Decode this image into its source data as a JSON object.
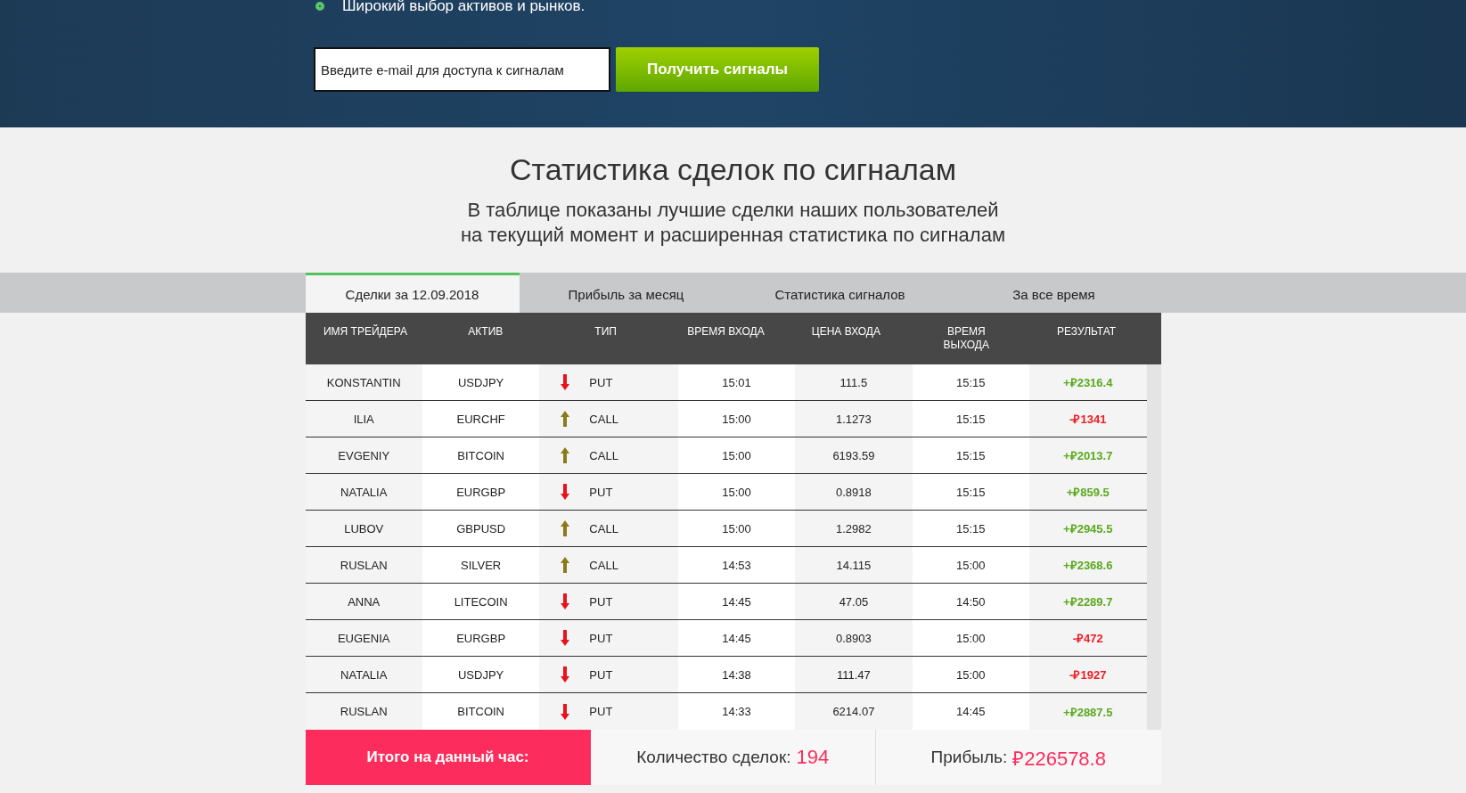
{
  "hero": {
    "feature": "Широкий выбор активов и рынков.",
    "email_field": {
      "placeholder": "Введите e-mail для доступа к сигналам"
    },
    "submit_button": "Получить сигналы"
  },
  "heading": {
    "title": "Статистика сделок по сигналам",
    "subtitle_lines": [
      "В таблице показаны лучшие сделки наших пользователей",
      "на текущий момент и расширенная статистика по сигналам"
    ]
  },
  "tabs": [
    {
      "label": "Сделки за 12.09.2018",
      "selected": true
    },
    {
      "label": "Прибыль за месяц",
      "selected": false
    },
    {
      "label": "Статистика сигналов",
      "selected": false
    },
    {
      "label": "За все время",
      "selected": false
    }
  ],
  "table": {
    "columns": [
      [
        "ИМЯ ТРЕЙДЕРА"
      ],
      [
        "АКТИВ"
      ],
      [
        "ТИП"
      ],
      [
        "ВРЕМЯ ВХОДА"
      ],
      [
        "ЦЕНА ВХОДА"
      ],
      [
        "ВРЕМЯ",
        "ВЫХОДА"
      ],
      [
        "РЕЗУЛЬТАТ"
      ]
    ],
    "rows": [
      {
        "trader": "KONSTANTIN",
        "asset": "USDJPY",
        "rising": false,
        "type": "PUT",
        "entry_time": "15:01",
        "entry_price": "111.5",
        "exit_time": "15:15",
        "result": "+₽2316.4",
        "profit": true
      },
      {
        "trader": "ILIA",
        "asset": "EURCHF",
        "rising": true,
        "type": "CALL",
        "entry_time": "15:00",
        "entry_price": "1.1273",
        "exit_time": "15:15",
        "result": "-₽1341",
        "profit": false
      },
      {
        "trader": "EVGENIY",
        "asset": "BITCOIN",
        "rising": true,
        "type": "CALL",
        "entry_time": "15:00",
        "entry_price": "6193.59",
        "exit_time": "15:15",
        "result": "+₽2013.7",
        "profit": true
      },
      {
        "trader": "NATALIA",
        "asset": "EURGBP",
        "rising": false,
        "type": "PUT",
        "entry_time": "15:00",
        "entry_price": "0.8918",
        "exit_time": "15:15",
        "result": "+₽859.5",
        "profit": true
      },
      {
        "trader": "LUBOV",
        "asset": "GBPUSD",
        "rising": true,
        "type": "CALL",
        "entry_time": "15:00",
        "entry_price": "1.2982",
        "exit_time": "15:15",
        "result": "+₽2945.5",
        "profit": true
      },
      {
        "trader": "RUSLAN",
        "asset": "SILVER",
        "rising": true,
        "type": "CALL",
        "entry_time": "14:53",
        "entry_price": "14.115",
        "exit_time": "15:00",
        "result": "+₽2368.6",
        "profit": true
      },
      {
        "trader": "ANNA",
        "asset": "LITECOIN",
        "rising": false,
        "type": "PUT",
        "entry_time": "14:45",
        "entry_price": "47.05",
        "exit_time": "14:50",
        "result": "+₽2289.7",
        "profit": true
      },
      {
        "trader": "EUGENIA",
        "asset": "EURGBP",
        "rising": false,
        "type": "PUT",
        "entry_time": "14:45",
        "entry_price": "0.8903",
        "exit_time": "15:00",
        "result": "-₽472",
        "profit": false
      },
      {
        "trader": "NATALIA",
        "asset": "USDJPY",
        "rising": false,
        "type": "PUT",
        "entry_time": "14:38",
        "entry_price": "111.47",
        "exit_time": "15:00",
        "result": "-₽1927",
        "profit": false
      },
      {
        "trader": "RUSLAN",
        "asset": "BITCOIN",
        "rising": false,
        "type": "PUT",
        "entry_time": "14:33",
        "entry_price": "6214.07",
        "exit_time": "14:45",
        "result": "+₽2887.5",
        "profit": true
      }
    ]
  },
  "totals": {
    "label": "Итого на данный час:",
    "count_label": "Количество сделок:",
    "count": "194",
    "profit_label": "Прибыль:",
    "profit": "₽226578.8"
  }
}
